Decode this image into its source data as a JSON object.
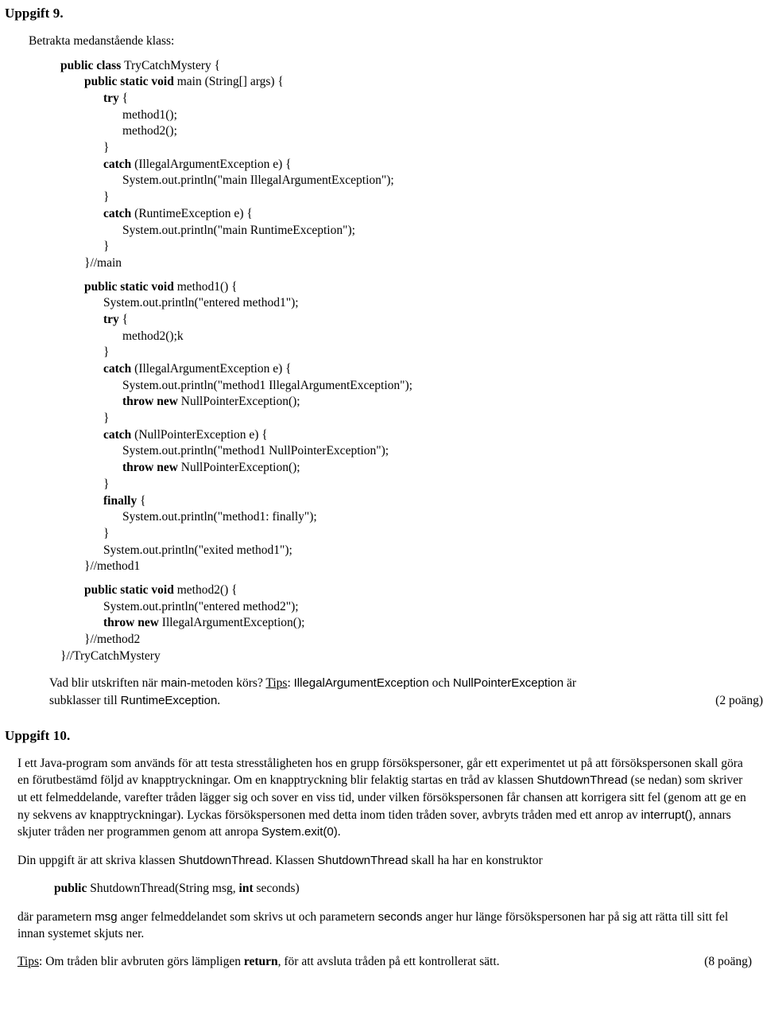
{
  "task9": {
    "heading": "Uppgift 9.",
    "intro": "Betrakta medanstående klass:",
    "code": [
      {
        "indent": 0,
        "segments": [
          {
            "t": "public class ",
            "b": true
          },
          {
            "t": "TryCatchMystery {",
            "b": false
          }
        ]
      },
      {
        "indent": 1,
        "segments": [
          {
            "t": "public static void ",
            "b": true
          },
          {
            "t": "main (String[] args) {",
            "b": false
          }
        ]
      },
      {
        "indent": 2,
        "segments": [
          {
            "t": "try ",
            "b": true
          },
          {
            "t": "{",
            "b": false
          }
        ]
      },
      {
        "indent": 3,
        "segments": [
          {
            "t": "method1();",
            "b": false
          }
        ]
      },
      {
        "indent": 3,
        "segments": [
          {
            "t": "method2();",
            "b": false
          }
        ]
      },
      {
        "indent": 2,
        "segments": [
          {
            "t": "}",
            "b": false
          }
        ]
      },
      {
        "indent": 2,
        "segments": [
          {
            "t": "catch ",
            "b": true
          },
          {
            "t": "(IllegalArgumentException e) {",
            "b": false
          }
        ]
      },
      {
        "indent": 3,
        "segments": [
          {
            "t": "System.out.println(\"main IllegalArgumentException\");",
            "b": false
          }
        ]
      },
      {
        "indent": 2,
        "segments": [
          {
            "t": "}",
            "b": false
          }
        ]
      },
      {
        "indent": 2,
        "segments": [
          {
            "t": "catch ",
            "b": true
          },
          {
            "t": "(RuntimeException e) {",
            "b": false
          }
        ]
      },
      {
        "indent": 3,
        "segments": [
          {
            "t": "System.out.println(\"main RuntimeException\");",
            "b": false
          }
        ]
      },
      {
        "indent": 2,
        "segments": [
          {
            "t": "}",
            "b": false
          }
        ]
      },
      {
        "indent": 1,
        "segments": [
          {
            "t": "}//main",
            "b": false
          }
        ]
      },
      {
        "indent": 0,
        "gap": true,
        "segments": []
      },
      {
        "indent": 1,
        "segments": [
          {
            "t": "public static void ",
            "b": true
          },
          {
            "t": "method1() {",
            "b": false
          }
        ]
      },
      {
        "indent": 2,
        "segments": [
          {
            "t": "System.out.println(\"entered method1\");",
            "b": false
          }
        ]
      },
      {
        "indent": 2,
        "segments": [
          {
            "t": "try ",
            "b": true
          },
          {
            "t": "{",
            "b": false
          }
        ]
      },
      {
        "indent": 3,
        "segments": [
          {
            "t": "method2();k",
            "b": false
          }
        ]
      },
      {
        "indent": 2,
        "segments": [
          {
            "t": "}",
            "b": false
          }
        ]
      },
      {
        "indent": 2,
        "segments": [
          {
            "t": "catch ",
            "b": true
          },
          {
            "t": "(IllegalArgumentException e) {",
            "b": false
          }
        ]
      },
      {
        "indent": 3,
        "segments": [
          {
            "t": "System.out.println(\"method1 IllegalArgumentException\");",
            "b": false
          }
        ]
      },
      {
        "indent": 3,
        "segments": [
          {
            "t": "throw new ",
            "b": true
          },
          {
            "t": "NullPointerException();",
            "b": false
          }
        ]
      },
      {
        "indent": 2,
        "segments": [
          {
            "t": "}",
            "b": false
          }
        ]
      },
      {
        "indent": 2,
        "segments": [
          {
            "t": "catch ",
            "b": true
          },
          {
            "t": "(NullPointerException e) {",
            "b": false
          }
        ]
      },
      {
        "indent": 3,
        "segments": [
          {
            "t": "System.out.println(\"method1 NullPointerException\");",
            "b": false
          }
        ]
      },
      {
        "indent": 3,
        "segments": [
          {
            "t": "throw new ",
            "b": true
          },
          {
            "t": "NullPointerException();",
            "b": false
          }
        ]
      },
      {
        "indent": 2,
        "segments": [
          {
            "t": "}",
            "b": false
          }
        ]
      },
      {
        "indent": 2,
        "segments": [
          {
            "t": "finally ",
            "b": true
          },
          {
            "t": "{",
            "b": false
          }
        ]
      },
      {
        "indent": 3,
        "segments": [
          {
            "t": "System.out.println(\"method1: finally\");",
            "b": false
          }
        ]
      },
      {
        "indent": 2,
        "segments": [
          {
            "t": "}",
            "b": false
          }
        ]
      },
      {
        "indent": 2,
        "segments": [
          {
            "t": "System.out.println(\"exited method1\");",
            "b": false
          }
        ]
      },
      {
        "indent": 1,
        "segments": [
          {
            "t": "}//method1",
            "b": false
          }
        ]
      },
      {
        "indent": 0,
        "gap": true,
        "segments": []
      },
      {
        "indent": 1,
        "segments": [
          {
            "t": "public static void ",
            "b": true
          },
          {
            "t": "method2() {",
            "b": false
          }
        ]
      },
      {
        "indent": 2,
        "segments": [
          {
            "t": "System.out.println(\"entered method2\");",
            "b": false
          }
        ]
      },
      {
        "indent": 2,
        "segments": [
          {
            "t": "throw new ",
            "b": true
          },
          {
            "t": "IllegalArgumentException();",
            "b": false
          }
        ]
      },
      {
        "indent": 1,
        "segments": [
          {
            "t": "}//method2",
            "b": false
          }
        ]
      },
      {
        "indent": 0,
        "segments": [
          {
            "t": "}//TryCatchMystery",
            "b": false
          }
        ]
      }
    ],
    "question_line1_a": "Vad blir utskriften när ",
    "question_line1_code1": "main",
    "question_line1_b": "-metoden körs? ",
    "question_line1_tips": "Tips",
    "question_line1_c": ": ",
    "question_line1_code2": "IllegalArgumentException",
    "question_line1_d": " och ",
    "question_line1_code3": "NullPointerException",
    "question_line1_e": " är",
    "question_line2_a": "subklasser till ",
    "question_line2_code": "RuntimeException",
    "question_line2_b": ".",
    "points": "(2 poäng)"
  },
  "task10": {
    "heading": "Uppgift 10.",
    "para1_a": "I ett Java-program som används för att testa stresståligheten hos en grupp försökspersoner, går ett experimentet ut på att försökspersonen skall göra en förutbestämd följd av knapptryckningar. Om en knapptryckning blir felaktig startas en tråd av klassen ",
    "para1_code1": "ShutdownThread",
    "para1_b": " (se nedan) som skriver ut ett felmeddelande, varefter tråden lägger sig och sover en viss tid, under vilken försökspersonen får chansen att korrigera sitt fel (genom att ge en ny sekvens av knapptryckningar). Lyckas försökspersonen med detta inom tiden tråden sover, avbryts tråden med ett anrop av ",
    "para1_code2": "interrupt()",
    "para1_c": ", annars skjuter tråden ner programmen genom att anropa ",
    "para1_code3": "System.exit(0)",
    "para1_d": ".",
    "para2_a": "Din uppgift är att skriva klassen ",
    "para2_code1": "ShutdownThread",
    "para2_b": ". Klassen ",
    "para2_code2": "ShutdownThread",
    "para2_c": " skall ha har en konstruktor",
    "signature_kw1": "public",
    "signature_mid": " ShutdownThread(String msg, ",
    "signature_kw2": "int",
    "signature_end": " seconds)",
    "para3_a": "där parametern ",
    "para3_code1": "msg",
    "para3_b": " anger felmeddelandet som skrivs ut och  parametern ",
    "para3_code2": "seconds",
    "para3_c": " anger hur länge försökspersonen har på sig att rätta till sitt fel innan systemet skjuts ner.",
    "tips_label": "Tips",
    "tips_a": ": Om tråden blir avbruten görs lämpligen ",
    "tips_kw": "return",
    "tips_b": ", för att avsluta tråden på ett kontrollerat sätt.",
    "points": "(8 poäng)"
  }
}
